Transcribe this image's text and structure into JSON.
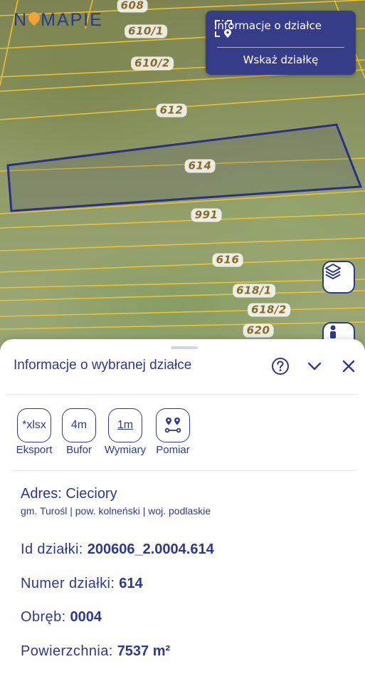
{
  "app": {
    "logo_text_left": "N",
    "logo_text_right": "MAPIE"
  },
  "map": {
    "parcel_labels": [
      "608",
      "610/1",
      "610/2",
      "612",
      "614",
      "991",
      "616",
      "618/1",
      "618/2",
      "620"
    ],
    "selected_parcel": "614",
    "colors": {
      "parcel_lines": "#f2c42f",
      "selection": "#2b2f86"
    }
  },
  "info_panel": {
    "info_label": "Informacje o działce",
    "point_label": "Wskaż działkę"
  },
  "fab": {
    "layers_icon": "layers-icon",
    "person_icon": "person-icon"
  },
  "sheet": {
    "title": "Informacje o wybranej działce",
    "tools": [
      {
        "icon_text": "*xlsx",
        "label": "Eksport"
      },
      {
        "icon_text": "4m",
        "label": "Bufor"
      },
      {
        "icon_text": "1m",
        "label": "Wymiary"
      },
      {
        "icon_text": "",
        "label": "Pomiar"
      }
    ],
    "address": {
      "title": "Adres: Cieciory",
      "subtitle": "gm. Turośl | pow. kolneński | woj. podlaskie"
    },
    "fields": [
      {
        "label": "Id działki: ",
        "value": "200606_2.0004.614"
      },
      {
        "label": "Numer działki: ",
        "value": "614"
      },
      {
        "label": "Obręb: ",
        "value": "0004"
      },
      {
        "label": "Powierzchnia: ",
        "value": "7537 m²"
      }
    ]
  },
  "colors": {
    "accent": "#2d3a8c",
    "panel_bg": "#363c87",
    "logo_pin": "#f0a537"
  }
}
